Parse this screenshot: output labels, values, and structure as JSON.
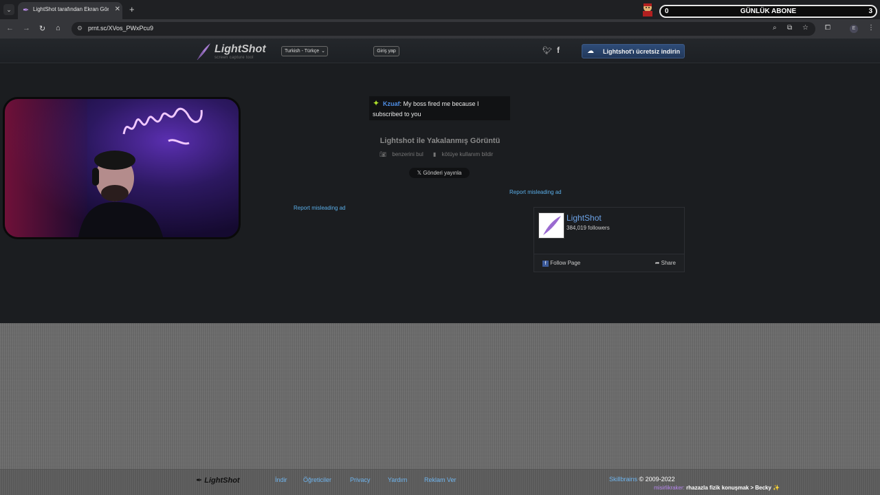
{
  "browser": {
    "tab_title": "LightShot tarafından Ekran Görüntüsü",
    "url": "prnt.sc/XVos_PWxPcu9",
    "new_tab": "+",
    "tab_close": "✕",
    "profile_initial": "E"
  },
  "overlay": {
    "counter_left": "0",
    "counter_title": "GÜNLÜK ABONE",
    "counter_right": "3"
  },
  "header": {
    "logo_text": "LightShot",
    "logo_tagline": "screen capture tool",
    "language": "Turkish - Türkçe",
    "login": "Giriş yap",
    "download": "Lightshot'ı ücretsiz indirin"
  },
  "chat": {
    "user": "Kzuaf",
    "message": ": My boss fired me because I subscribed to you"
  },
  "capture": {
    "title": "Lightshot ile Yakalanmış Görüntü",
    "find_similar": "benzerini bul",
    "report_abuse": "kötüye kullanım bildir",
    "share_x": "Gönderi yayınla"
  },
  "ads": {
    "report_left": "Report misleading ad",
    "report_right": "Report misleading ad"
  },
  "fb_widget": {
    "page_name": "LightShot",
    "followers": "384,019 followers",
    "follow": "Follow Page",
    "share": "Share"
  },
  "footer": {
    "logo": "LightShot",
    "links": [
      "İndir",
      "Öğreticiler",
      "Privacy",
      "Yardım",
      "Reklam Ver"
    ],
    "brand": "Skillbrains",
    "copyright": " © 2009-2022"
  },
  "now_playing": {
    "user": "misirlikraker:",
    "text": " rhazazla fizik konuşmak > Becky"
  }
}
